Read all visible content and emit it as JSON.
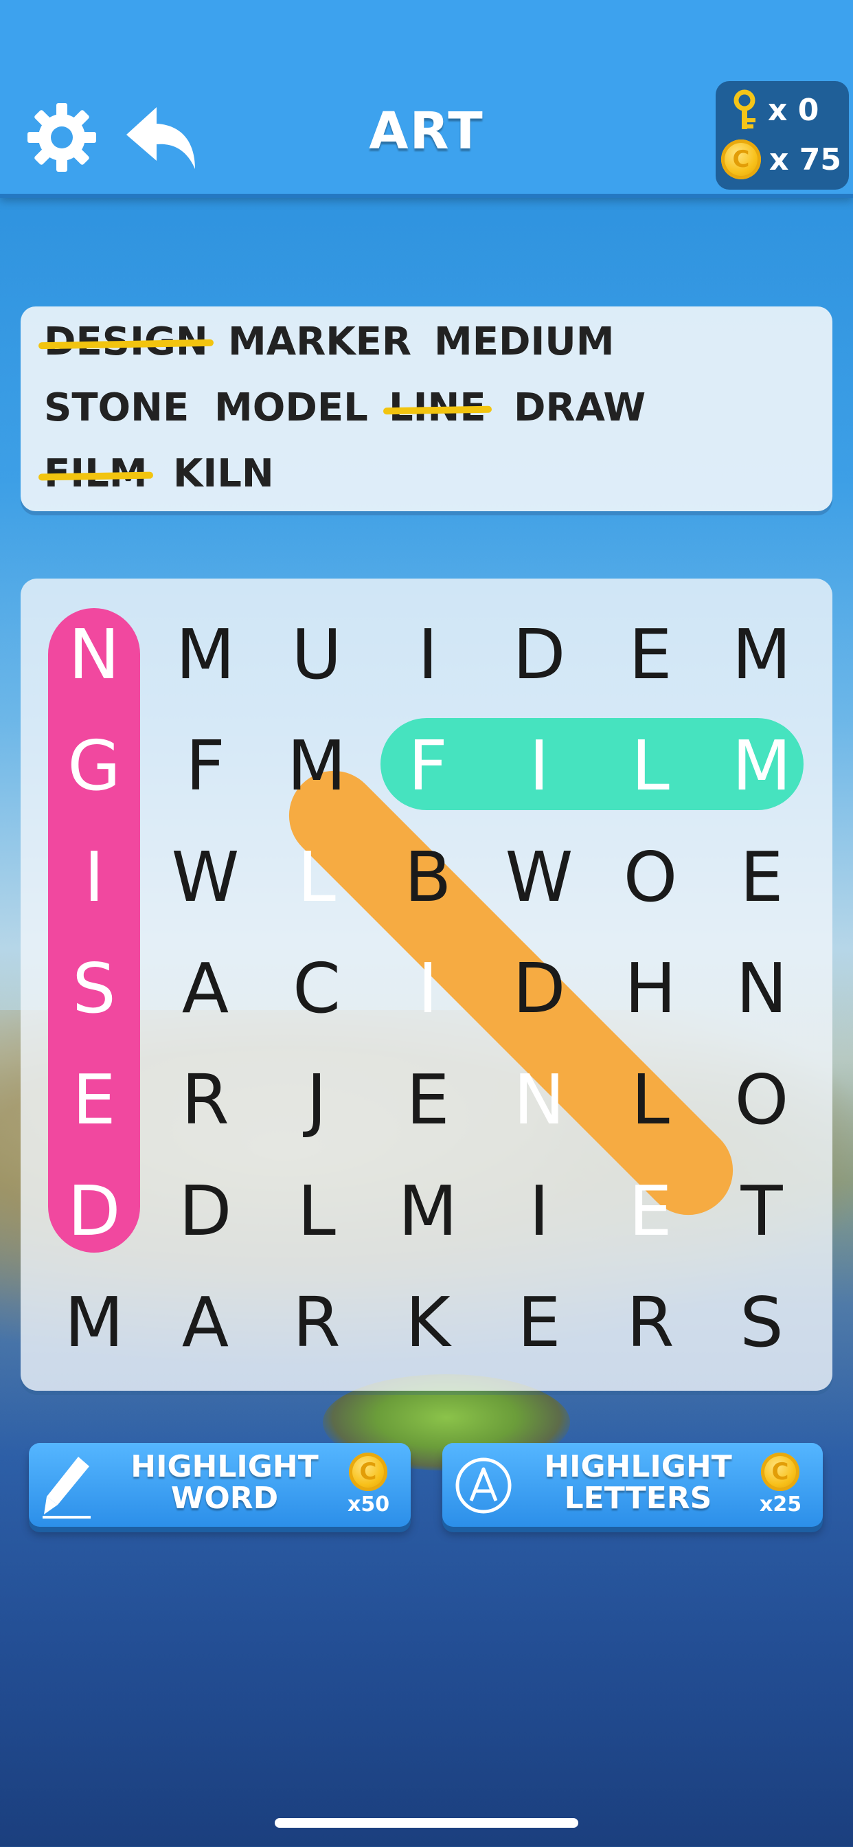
{
  "header": {
    "title": "ART",
    "keys_count": "x 0",
    "coins_count": "x 75",
    "settings_icon": "gear-icon",
    "back_icon": "undo-arrow-icon",
    "key_icon": "key-icon",
    "coin_icon": "coin-icon",
    "coin_letter": "C"
  },
  "words": [
    {
      "text": "DESIGN",
      "found": true
    },
    {
      "text": "MARKER",
      "found": false
    },
    {
      "text": "MEDIUM",
      "found": false
    },
    {
      "text": "STONE",
      "found": false
    },
    {
      "text": "MODEL",
      "found": false
    },
    {
      "text": "LINE",
      "found": true
    },
    {
      "text": "DRAW",
      "found": false
    },
    {
      "text": "FILM",
      "found": true
    },
    {
      "text": "KILN",
      "found": false
    }
  ],
  "grid": [
    [
      "N",
      "M",
      "U",
      "I",
      "D",
      "E",
      "M"
    ],
    [
      "G",
      "F",
      "M",
      "F",
      "I",
      "L",
      "M"
    ],
    [
      "I",
      "W",
      "L",
      "B",
      "W",
      "O",
      "E"
    ],
    [
      "S",
      "A",
      "C",
      "I",
      "D",
      "H",
      "N"
    ],
    [
      "E",
      "R",
      "J",
      "E",
      "N",
      "L",
      "O"
    ],
    [
      "D",
      "D",
      "L",
      "M",
      "I",
      "E",
      "T"
    ],
    [
      "M",
      "A",
      "R",
      "K",
      "E",
      "R",
      "S"
    ]
  ],
  "highlights": {
    "DESIGN": "#f1489f",
    "FILM": "#46e3bf",
    "LINE": "#f6ab42"
  },
  "hints": {
    "highlight_word": {
      "line1": "HIGHLIGHT",
      "line2": "WORD",
      "cost": "x50"
    },
    "highlight_letters": {
      "line1": "HIGHLIGHT",
      "line2": "LETTERS",
      "cost": "x25"
    }
  },
  "colors": {
    "strike": "#f2c40f",
    "topbar": "#3da2ee",
    "hint_button": "#2c8fe9"
  }
}
